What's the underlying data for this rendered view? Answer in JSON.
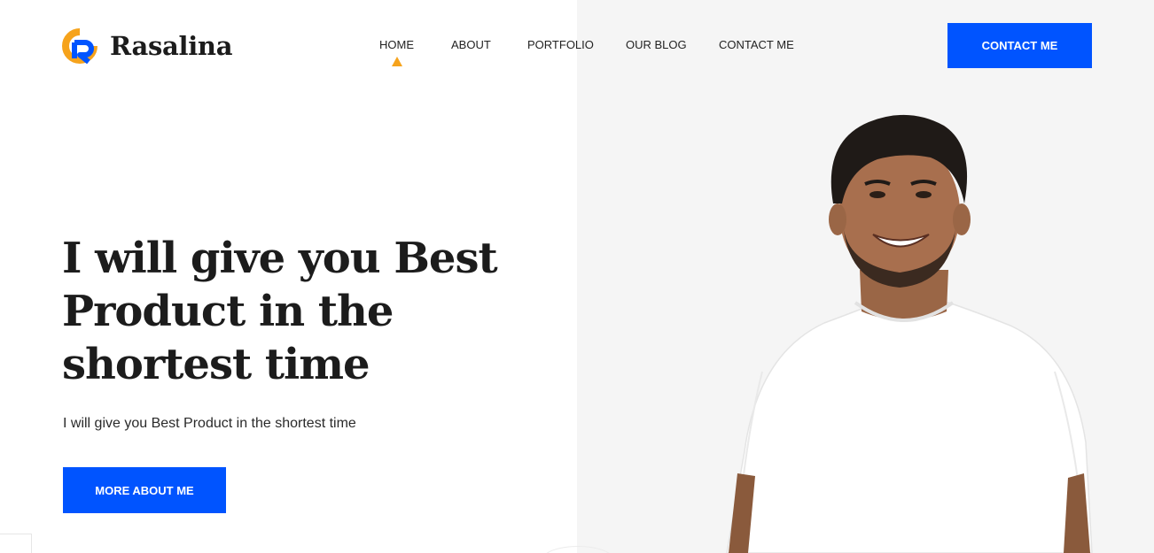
{
  "brand": {
    "name": "Rasalina",
    "logo_colors": {
      "blue": "#0054ff",
      "orange": "#f6a31c"
    }
  },
  "nav": {
    "items": [
      {
        "label": "HOME",
        "active": true
      },
      {
        "label": "ABOUT",
        "active": false
      },
      {
        "label": "PORTFOLIO",
        "active": false
      },
      {
        "label": "OUR BLOG",
        "active": false
      },
      {
        "label": "CONTACT ME",
        "active": false
      }
    ],
    "active_indicator_color": "#f6a31c"
  },
  "header_cta": {
    "label": "CONTACT ME",
    "color": "#0054ff"
  },
  "hero": {
    "title_lines": [
      "I will give you Best",
      "Product in the",
      "shortest time"
    ],
    "subtitle": "I will give you Best Product in the shortest time",
    "button_label": "MORE ABOUT ME",
    "button_color": "#0054ff"
  },
  "portrait": {
    "icon": "person-portrait-icon",
    "background": "#f5f5f5"
  }
}
